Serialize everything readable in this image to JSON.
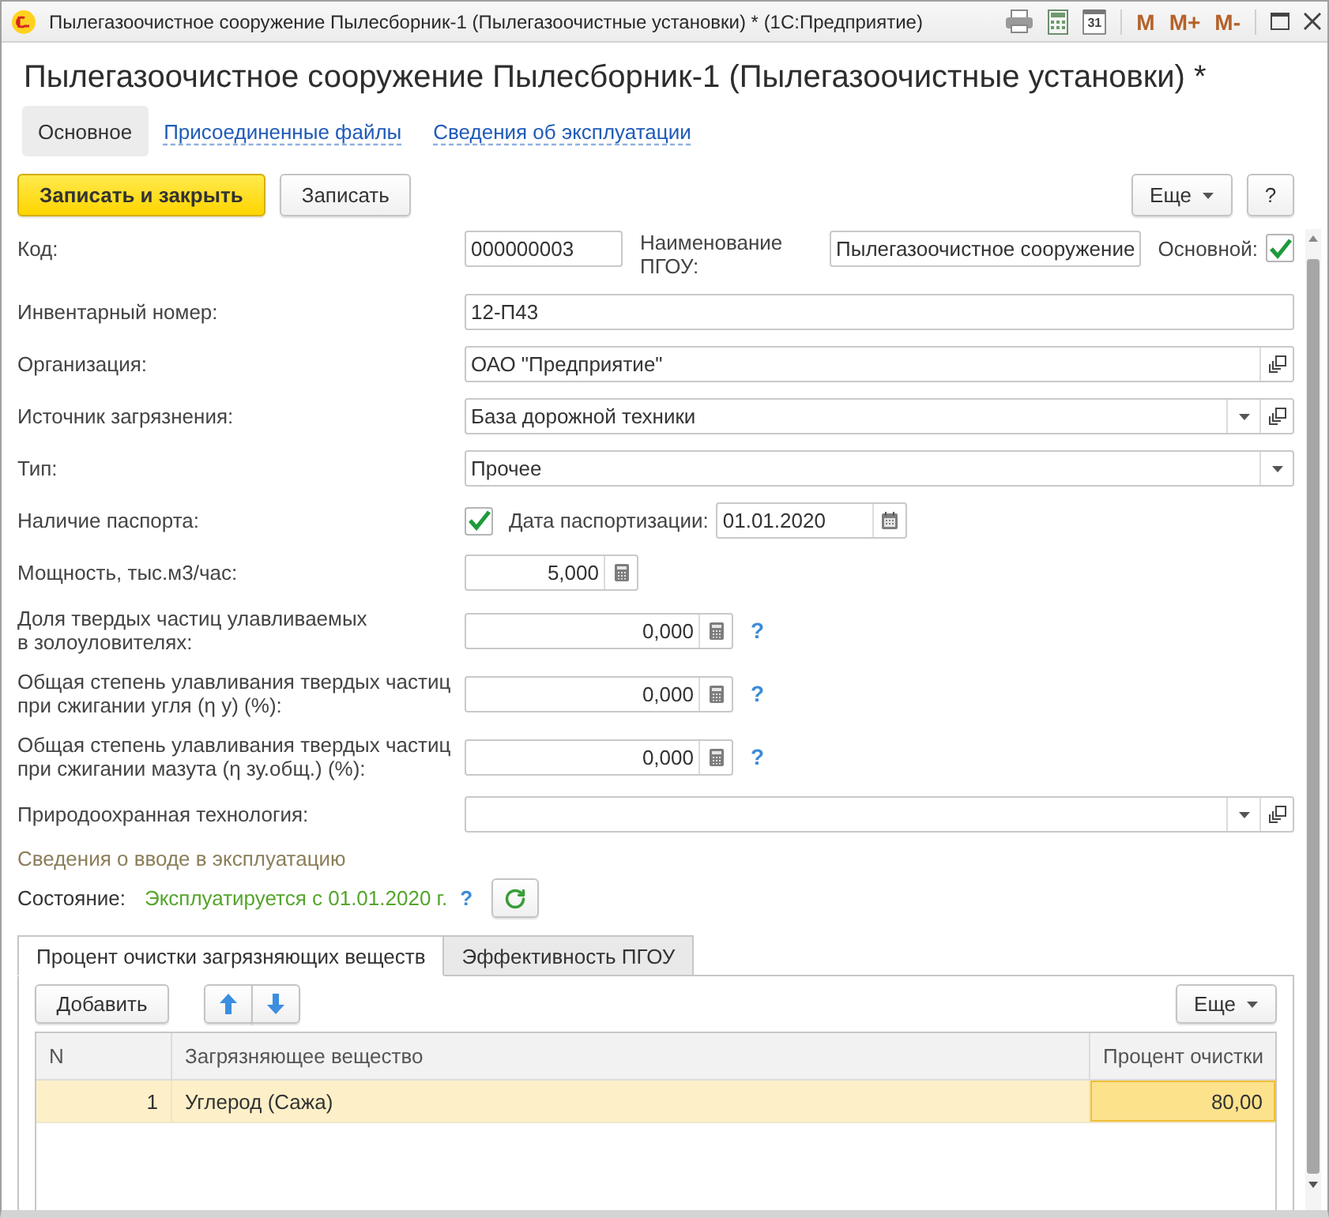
{
  "window": {
    "title": "Пылегазоочистное сооружение Пылесборник-1 (Пылегазоочистные установки) * (1С:Предприятие)",
    "calendar_day": "31",
    "memory_buttons": [
      "M",
      "M+",
      "M-"
    ]
  },
  "form": {
    "title": "Пылегазоочистное сооружение Пылесборник-1 (Пылегазоочистные установки) *",
    "nav": [
      {
        "label": "Основное",
        "selected": true
      },
      {
        "label": "Присоединенные файлы",
        "selected": false
      },
      {
        "label": "Сведения об эксплуатации",
        "selected": false
      }
    ],
    "commands": [
      {
        "label": "Записать и закрыть",
        "kind": "primary"
      },
      {
        "label": "Записать",
        "kind": "plain"
      }
    ],
    "more_button": "Еще",
    "help_button": "?",
    "code": {
      "label": "Код:",
      "value": "000000003"
    },
    "name": {
      "label": "Наименование\nПГОУ:",
      "value": "Пылегазоочистное сооружение"
    },
    "main": {
      "label": "Основной:",
      "checked": true
    },
    "fields": [
      {
        "kind": "text",
        "label": "Инвентарный номер:",
        "value": "12-П43"
      },
      {
        "kind": "ref",
        "label": "Организация:",
        "value": "ОАО \"Предприятие\""
      },
      {
        "kind": "ref_select",
        "label": "Источник загрязнения:",
        "value": "База дорожной техники"
      },
      {
        "kind": "select",
        "label": "Тип:",
        "value": "Прочее"
      },
      {
        "kind": "passport",
        "label": "Наличие паспорта:",
        "checked": true,
        "date_label": "Дата паспортизации:",
        "date": "01.01.2020"
      },
      {
        "kind": "number",
        "label": "Мощность, тыс.м3/час:",
        "value": "5,000"
      },
      {
        "kind": "number",
        "label": "Доля твердых частиц улавливаемых\nв золоуловителях:",
        "value": "0,000",
        "hint": "?"
      },
      {
        "kind": "number",
        "label": "Общая степень улавливания твердых частиц\nпри сжигании угля (η у) (%):",
        "value": "0,000",
        "hint": "?"
      },
      {
        "kind": "number",
        "label": "Общая степень улавливания твердых частиц\nпри сжигании мазута (η зу.общ.) (%):",
        "value": "0,000",
        "hint": "?"
      },
      {
        "kind": "ref_select",
        "label": "Природоохранная технология:"
      }
    ],
    "commissioning": {
      "heading": "Сведения о вводе в эксплуатацию",
      "label": "Состояние:",
      "value": "Эксплуатируется с 01.01.2020 г.",
      "hint": "?"
    },
    "tabs": [
      {
        "label": "Процент очистки загрязняющих веществ",
        "selected": true
      },
      {
        "label": "Эффективность ПГОУ",
        "selected": false
      }
    ],
    "table_toolbar": {
      "add_button": "Добавить",
      "more_button": "Еще"
    },
    "table": {
      "columns": [
        "N",
        "Загрязняющее вещество",
        "Процент очистки"
      ],
      "rows": [
        {
          "selected": true,
          "cells": [
            {
              "text": "1",
              "focused": false
            },
            {
              "text": "Углерод (Сажа)",
              "focused": false
            },
            {
              "text": "80,00",
              "focused": true
            }
          ]
        }
      ]
    }
  }
}
